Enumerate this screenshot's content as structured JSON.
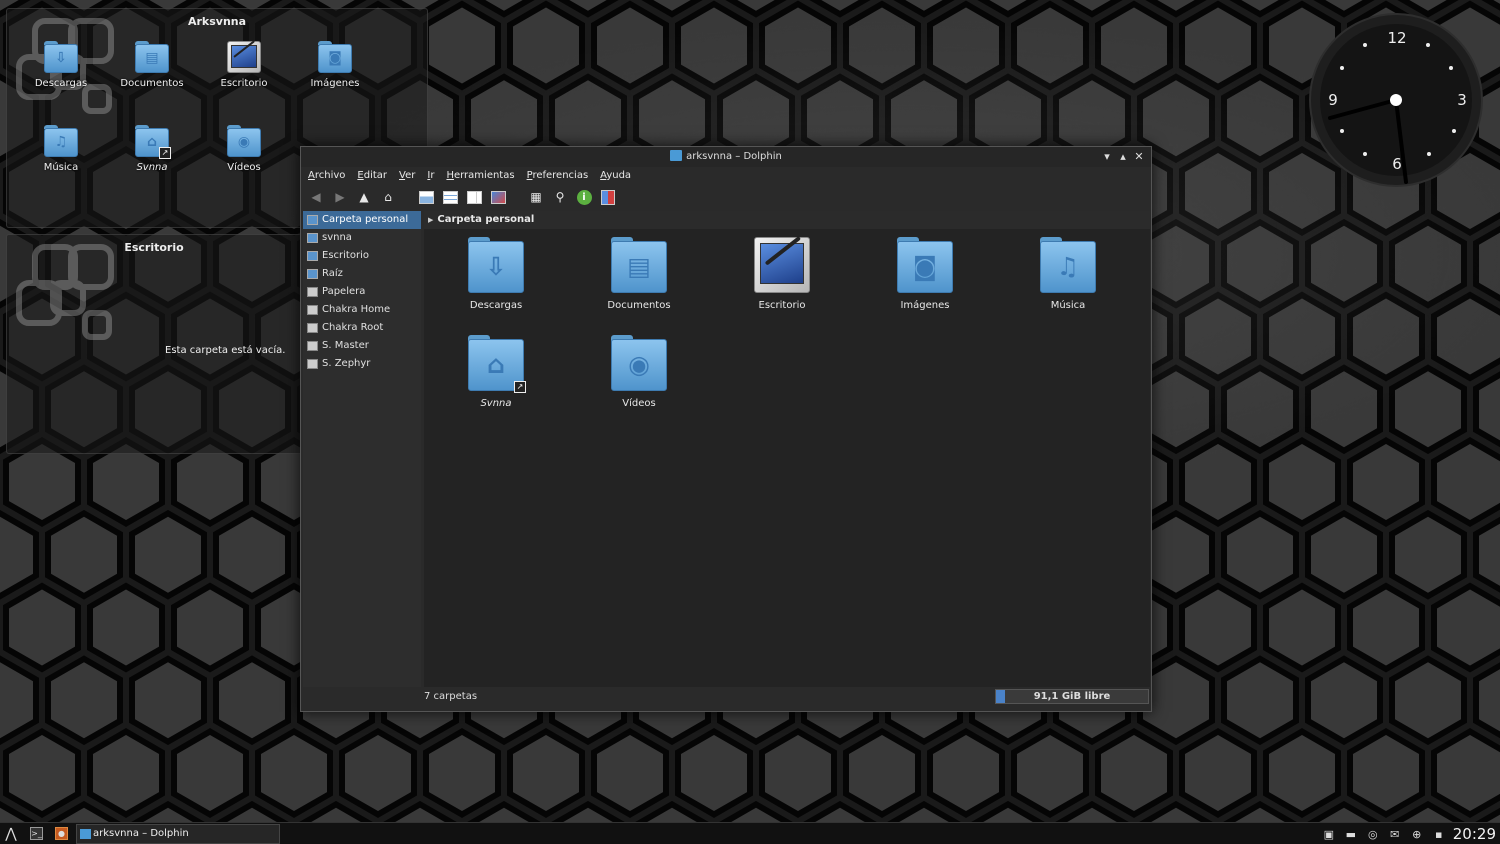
{
  "desktop": {
    "folderview_home": {
      "title": "Arksvnna",
      "icons": [
        {
          "label": "Descargas",
          "type": "folder",
          "glyph": "⇩"
        },
        {
          "label": "Documentos",
          "type": "folder",
          "glyph": "▤"
        },
        {
          "label": "Escritorio",
          "type": "desktop",
          "glyph": ""
        },
        {
          "label": "Imágenes",
          "type": "folder",
          "glyph": "◙"
        },
        {
          "label": "Música",
          "type": "folder",
          "glyph": "♫"
        },
        {
          "label": "Svnna",
          "type": "folder-link",
          "glyph": "⌂"
        },
        {
          "label": "Vídeos",
          "type": "folder",
          "glyph": "◉"
        }
      ]
    },
    "folderview_desktop": {
      "title": "Escritorio",
      "empty_message": "Esta carpeta está vacía."
    },
    "clock": {
      "n12": "12",
      "n3": "3",
      "n6": "6",
      "n9": "9"
    }
  },
  "window": {
    "title": "arksvnna – Dolphin",
    "controls": {
      "minimize": "▾",
      "maximize": "▴",
      "close": "✕"
    },
    "menu": [
      "Archivo",
      "Editar",
      "Ver",
      "Ir",
      "Herramientas",
      "Preferencias",
      "Ayuda"
    ],
    "places": [
      {
        "label": "Carpeta personal",
        "selected": true,
        "kind": "home"
      },
      {
        "label": "svnna",
        "kind": "folder"
      },
      {
        "label": "Escritorio",
        "kind": "folder"
      },
      {
        "label": "Raíz",
        "kind": "folder"
      },
      {
        "label": "Papelera",
        "kind": "trash"
      },
      {
        "label": "Chakra Home",
        "kind": "device"
      },
      {
        "label": "Chakra Root",
        "kind": "device"
      },
      {
        "label": "S. Master",
        "kind": "device"
      },
      {
        "label": "S. Zephyr",
        "kind": "device"
      }
    ],
    "breadcrumb": "Carpeta personal",
    "items": [
      {
        "label": "Descargas",
        "type": "folder",
        "glyph": "⇩"
      },
      {
        "label": "Documentos",
        "type": "folder",
        "glyph": "▤"
      },
      {
        "label": "Escritorio",
        "type": "desktop",
        "glyph": ""
      },
      {
        "label": "Imágenes",
        "type": "folder",
        "glyph": "◙"
      },
      {
        "label": "Música",
        "type": "folder",
        "glyph": "♫"
      },
      {
        "label": "Svnna",
        "type": "folder-link",
        "glyph": "⌂"
      },
      {
        "label": "Vídeos",
        "type": "folder",
        "glyph": "◉"
      }
    ],
    "status": {
      "count": "7 carpetas",
      "free": "91,1 GiB libre",
      "used_fraction": 0.06
    }
  },
  "taskbar": {
    "task": "arksvnna – Dolphin",
    "time": "20:29"
  },
  "colors": {
    "accent": "#3c6a98",
    "folder": "#6aaee4"
  }
}
